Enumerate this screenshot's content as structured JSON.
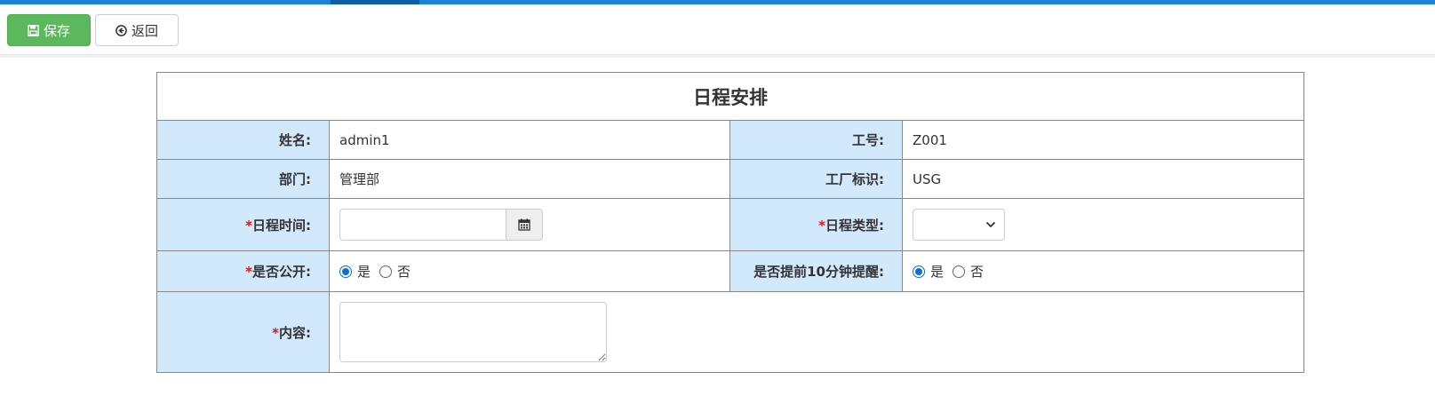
{
  "toolbar": {
    "save_label": "保存",
    "back_label": "返回",
    "save_color": "#5cb85c"
  },
  "form": {
    "title": "日程安排",
    "required_mark": "*",
    "name_label": "姓名:",
    "name_value": "admin1",
    "emp_id_label": "工号:",
    "emp_id_value": "Z001",
    "dept_label": "部门:",
    "dept_value": "管理部",
    "factory_label": "工厂标识:",
    "factory_value": "USG",
    "schedule_time_label": "日程时间:",
    "schedule_time_value": "",
    "schedule_type_label": "日程类型:",
    "schedule_type_value": "",
    "is_public_label": "是否公开:",
    "is_public_options": [
      "是",
      "否"
    ],
    "is_public_selected": "是",
    "remind_label": "是否提前10分钟提醒:",
    "remind_options": [
      "是",
      "否"
    ],
    "remind_selected": "是",
    "content_label": "内容:",
    "content_value": "",
    "label_bg_color": "#d2e8fb",
    "required_color": "#e2131a"
  },
  "icons": {
    "save": "floppy-disk-icon",
    "back": "circle-arrow-left-icon",
    "calendar": "calendar-icon",
    "select": "chevron-down-icon"
  }
}
